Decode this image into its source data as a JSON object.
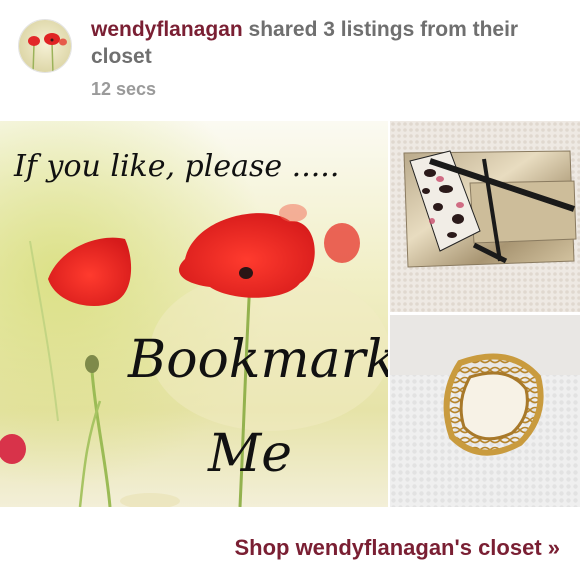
{
  "post": {
    "username": "wendyflanagan",
    "action_text": " shared 3 listings from their closet",
    "timestamp": "12 secs",
    "avatar_icon": "poppy-flowers-avatar",
    "listings": [
      {
        "image": "bookmark-me-poppies",
        "overlay_text": {
          "line1": "If you like, please .....",
          "line2": "Bookmark",
          "line3": "Me"
        }
      },
      {
        "image": "victorias-secret-cosmetic-bags"
      },
      {
        "image": "gold-lattice-bangle"
      }
    ],
    "shop_link": "Shop wendyflanagan's closet »"
  },
  "colors": {
    "brand": "#7a1f33",
    "secondary_text": "#7e7e7e",
    "timestamp": "#9a9a9a"
  }
}
